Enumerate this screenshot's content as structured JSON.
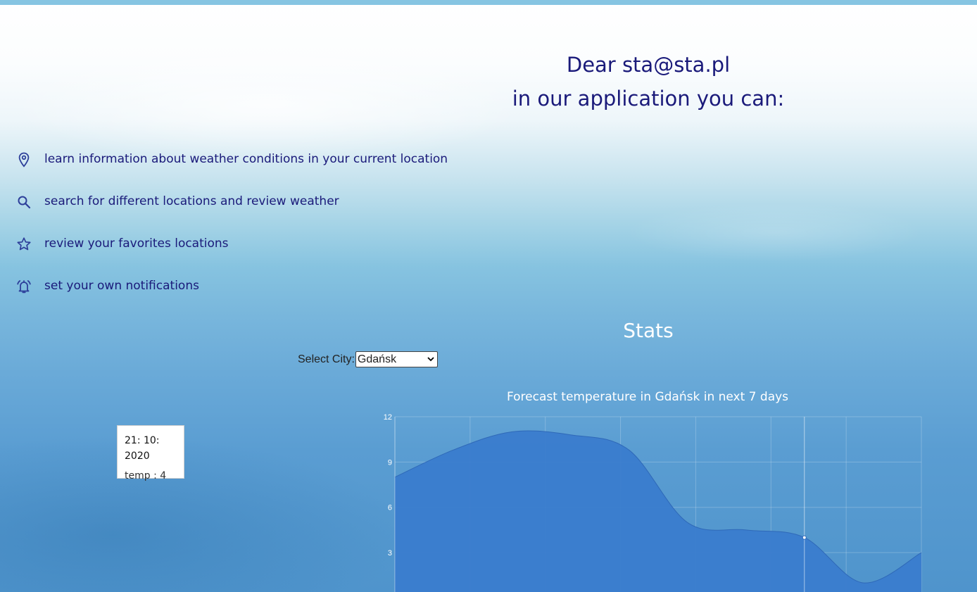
{
  "greeting": {
    "line1": "Dear sta@sta.pl",
    "line2": "in our application you can:"
  },
  "features": [
    {
      "icon": "location-pin-icon",
      "text": "learn information about weather conditions in your current location"
    },
    {
      "icon": "search-icon",
      "text": "search for different locations and review weather"
    },
    {
      "icon": "star-icon",
      "text": "review your favorites locations"
    },
    {
      "icon": "alarm-bell-icon",
      "text": "set your own notifications"
    }
  ],
  "stats": {
    "title": "Stats",
    "select_label": "Select City:",
    "selected_city": "Gdańsk"
  },
  "tooltip": {
    "date": "21: 10: 2020",
    "temp": "temp : 4"
  },
  "colors": {
    "text_primary": "#1a1a7a",
    "area_fill": "#3a7ccd",
    "top_bar": "#86c5e2"
  },
  "chart_data": {
    "type": "area",
    "title": "Forecast temperature in Gdańsk in next 7 days",
    "xlabel": "",
    "ylabel": "",
    "ylim": [
      0,
      12
    ],
    "yticks": [
      3,
      6,
      9,
      12
    ],
    "grid": true,
    "series": [
      {
        "values": [
          8,
          9.8,
          11,
          10.8,
          9.8,
          5,
          4.5,
          4,
          1,
          3
        ]
      }
    ],
    "highlighted_index": 7
  }
}
